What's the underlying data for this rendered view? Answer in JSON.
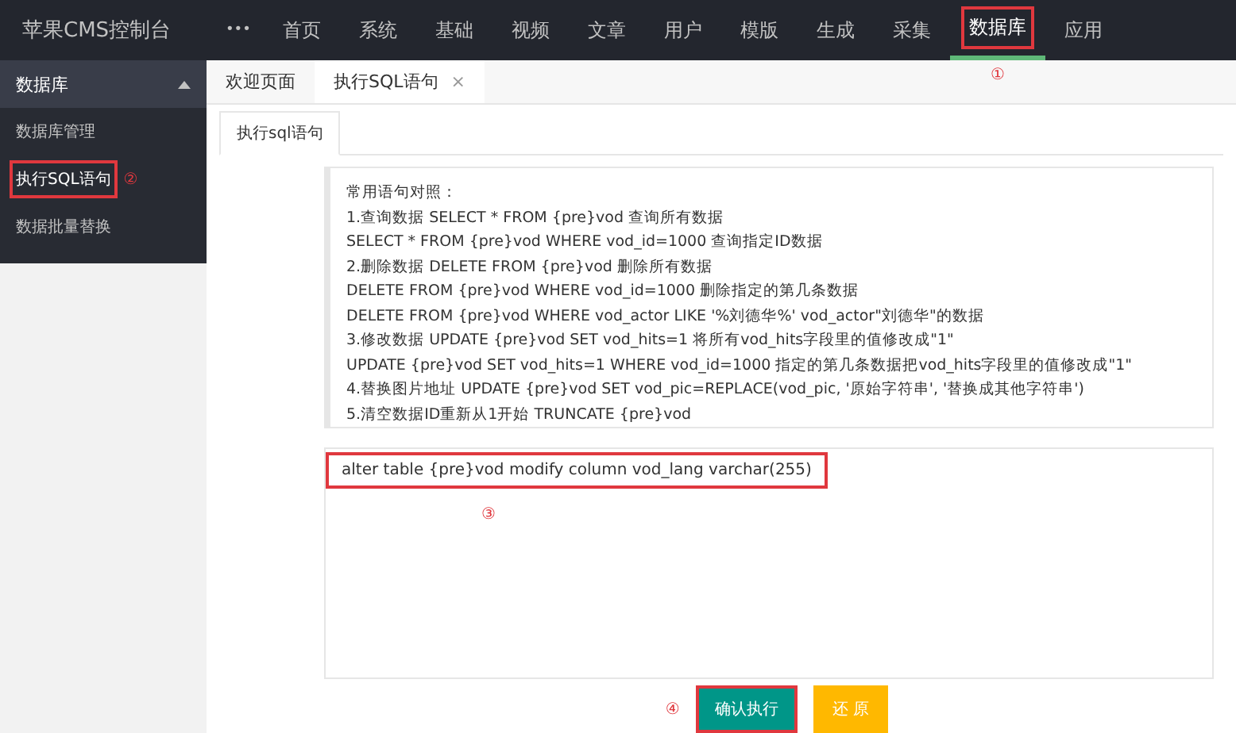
{
  "app_title": "苹果CMS控制台",
  "more_icon": "•••",
  "nav": [
    {
      "label": "首页",
      "selected": false,
      "highlighted": false
    },
    {
      "label": "系统",
      "selected": false,
      "highlighted": false
    },
    {
      "label": "基础",
      "selected": false,
      "highlighted": false
    },
    {
      "label": "视频",
      "selected": false,
      "highlighted": false
    },
    {
      "label": "文章",
      "selected": false,
      "highlighted": false
    },
    {
      "label": "用户",
      "selected": false,
      "highlighted": false
    },
    {
      "label": "模版",
      "selected": false,
      "highlighted": false
    },
    {
      "label": "生成",
      "selected": false,
      "highlighted": false
    },
    {
      "label": "采集",
      "selected": false,
      "highlighted": false
    },
    {
      "label": "数据库",
      "selected": true,
      "highlighted": true,
      "step": "①"
    },
    {
      "label": "应用",
      "selected": false,
      "highlighted": false
    }
  ],
  "sidebar": {
    "title": "数据库",
    "expanded": true,
    "items": [
      {
        "label": "数据库管理",
        "selected": false,
        "highlighted": false
      },
      {
        "label": "执行SQL语句",
        "selected": true,
        "highlighted": true,
        "step": "②"
      },
      {
        "label": "数据批量替换",
        "selected": false,
        "highlighted": false
      }
    ]
  },
  "page_tabs": [
    {
      "label": "欢迎页面",
      "selected": false,
      "closable": false
    },
    {
      "label": "执行SQL语句",
      "selected": true,
      "closable": true,
      "close": "×"
    }
  ],
  "inner_tabs": [
    {
      "label": "执行sql语句",
      "selected": true
    }
  ],
  "reference_lines": [
    "常用语句对照：",
    "1.查询数据 SELECT * FROM {pre}vod 查询所有数据",
    "SELECT * FROM {pre}vod WHERE vod_id=1000 查询指定ID数据",
    "2.删除数据 DELETE FROM {pre}vod 删除所有数据",
    "DELETE FROM {pre}vod WHERE vod_id=1000 删除指定的第几条数据",
    "DELETE FROM {pre}vod WHERE vod_actor LIKE '%刘德华%' vod_actor\"刘德华\"的数据",
    "3.修改数据 UPDATE {pre}vod SET vod_hits=1 将所有vod_hits字段里的值修改成\"1\"",
    "UPDATE {pre}vod SET vod_hits=1 WHERE vod_id=1000 指定的第几条数据把vod_hits字段里的值修改成\"1\"",
    "4.替换图片地址 UPDATE {pre}vod SET vod_pic=REPLACE(vod_pic, '原始字符串', '替换成其他字符串')",
    "5.清空数据ID重新从1开始 TRUNCATE {pre}vod"
  ],
  "sql_input": {
    "value": "alter table {pre}vod modify column vod_lang varchar(255)",
    "highlighted": true,
    "step": "③"
  },
  "buttons": [
    {
      "label": "确认执行",
      "kind": "primary",
      "highlighted": true,
      "step": "④"
    },
    {
      "label": "还 原",
      "kind": "warning",
      "highlighted": false
    }
  ]
}
